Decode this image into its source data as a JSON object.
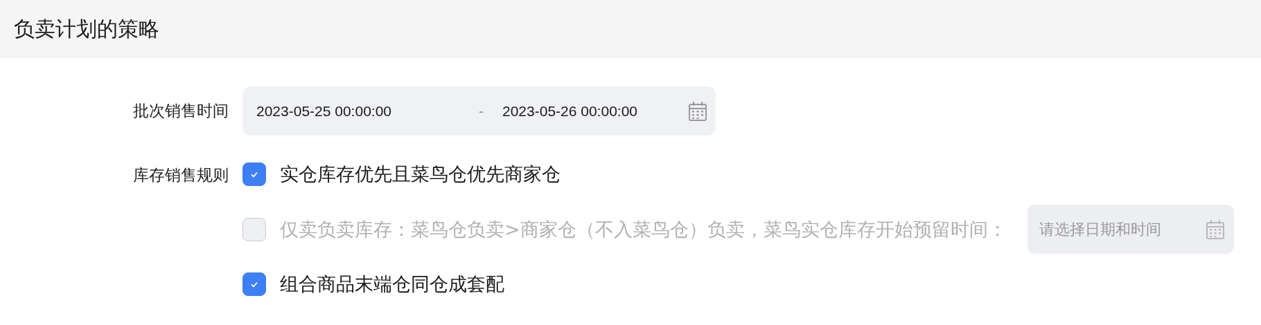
{
  "section": {
    "title": "负卖计划的策略"
  },
  "fields": [
    {
      "kind": "date_range",
      "label": "批次销售时间",
      "start": "2023-05-25 00:00:00",
      "separator": "-",
      "end": "2023-05-26 00:00:00"
    },
    {
      "kind": "checkbox_group",
      "label": "库存销售规则",
      "options": [
        {
          "text": "实仓库存优先且菜鸟仓优先商家仓",
          "checked": true,
          "disabled": false
        },
        {
          "text": "仅卖负卖库存：菜鸟仓负卖>商家仓（不入菜鸟仓）负卖，菜鸟实仓库存开始预留时间：",
          "checked": false,
          "disabled": true,
          "date_field": {
            "placeholder": "请选择日期和时间",
            "disabled": true
          }
        },
        {
          "text": "组合商品末端仓同仓成套配",
          "checked": true,
          "disabled": false
        }
      ]
    }
  ]
}
